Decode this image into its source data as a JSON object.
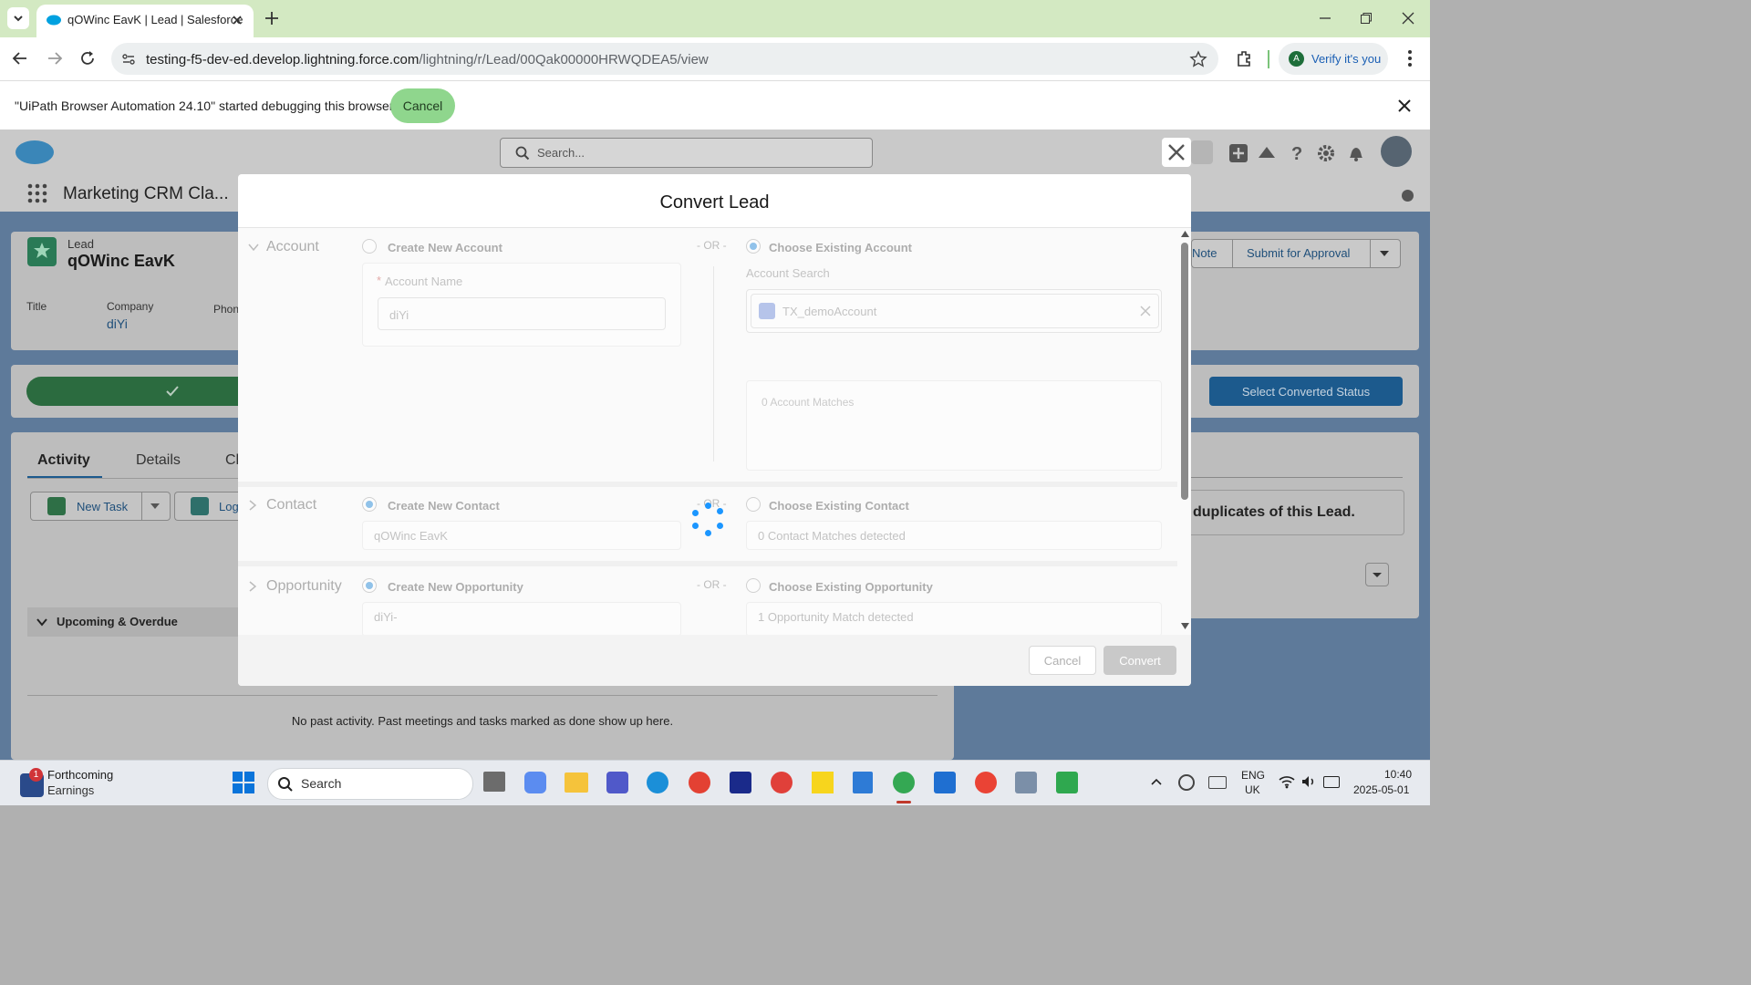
{
  "browser": {
    "tab_title": "qOWinc EavK | Lead | Salesforce",
    "url_host": "testing-f5-dev-ed.develop.lightning.force.com",
    "url_path": "/lightning/r/Lead/00Qak00000HRWQDEA5/view",
    "verify_label": "Verify it's you",
    "profile_letter": "A"
  },
  "debug_bar": {
    "message": "\"UiPath Browser Automation 24.10\" started debugging this browser",
    "cancel_label": "Cancel"
  },
  "app": {
    "search_placeholder": "Search...",
    "app_name": "Marketing CRM Cla...",
    "record_type": "Lead",
    "record_name": "qOWinc EavK",
    "fields": {
      "title_label": "Title",
      "company_label": "Company",
      "company_value": "diYi",
      "phone_label": "Phon"
    },
    "actions": {
      "note": "Note",
      "submit": "Submit for Approval"
    },
    "select_status": "Select Converted Status",
    "tabs": [
      "Activity",
      "Details",
      "Ch"
    ],
    "new_task": "New Task",
    "log": "Log",
    "upcoming": "Upcoming & Overdue",
    "no_activity": "No past activity. Past meetings and tasks marked as done show up here.",
    "duplicates": "duplicates of this Lead."
  },
  "modal": {
    "title": "Convert Lead",
    "or_label": "- OR -",
    "account": {
      "section": "Account",
      "create_new": "Create New Account",
      "name_label": "Account Name",
      "name_value": "diYi",
      "choose_existing": "Choose Existing Account",
      "search_label": "Account Search",
      "selected": "TX_demoAccount",
      "matches": "0 Account Matches"
    },
    "contact": {
      "section": "Contact",
      "create_new": "Create New Contact",
      "value": "qOWinc EavK",
      "choose_existing": "Choose Existing Contact",
      "matches": "0 Contact Matches detected"
    },
    "opportunity": {
      "section": "Opportunity",
      "create_new": "Create New Opportunity",
      "value": "diYi-",
      "choose_existing": "Choose Existing Opportunity",
      "matches": "1 Opportunity Match detected"
    },
    "cancel_label": "Cancel",
    "convert_label": "Convert"
  },
  "taskbar": {
    "notification_count": "1",
    "widget_title": "Forthcoming",
    "widget_sub": "Earnings",
    "search_label": "Search",
    "lang": "ENG",
    "region": "UK",
    "time": "10:40",
    "date": "2025-05-01"
  },
  "colors": {
    "accent": "#0176d3",
    "progress_green": "#2e844a",
    "salesforce_blue": "#00a1e0",
    "tab_strip": "#d3e9c2"
  }
}
